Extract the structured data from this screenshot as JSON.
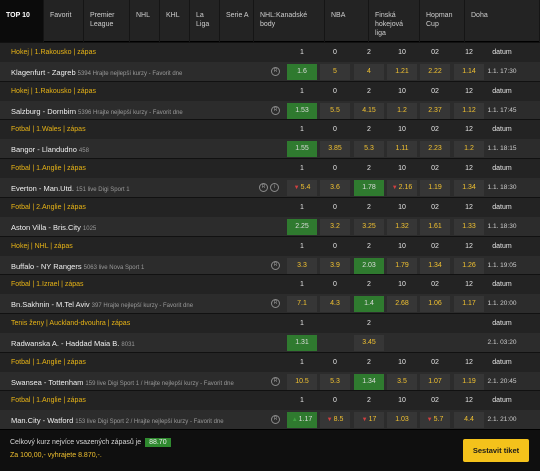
{
  "tabs": [
    "TOP 10",
    "Favorit",
    "Premier League",
    "NHL",
    "KHL",
    "La Liga",
    "Serie A",
    "NHL:Kanadské body",
    "NBA",
    "Finská hokejová liga",
    "Hopman Cup",
    "Doha"
  ],
  "col_headers": [
    "1",
    "0",
    "2",
    "10",
    "02",
    "12",
    "datum"
  ],
  "matches": [
    {
      "league": "Hokej | 1.Rakousko | zápas",
      "teams": "Klagenfurt - Zagreb",
      "info": "5394 Hrajte nejlepší kurzy - Favorit dne",
      "icons": [
        "R"
      ],
      "odds": [
        "1.6",
        "5",
        "4",
        "1.21",
        "2.22",
        "1.14"
      ],
      "selected": [
        0
      ],
      "arrows": [
        "",
        "",
        "",
        "",
        "",
        ""
      ],
      "date": "1.1. 17:30"
    },
    {
      "league": "Hokej | 1.Rakousko | zápas",
      "teams": "Salzburg - Dornbirn",
      "info": "5396 Hrajte nejlepší kurzy - Favorit dne",
      "icons": [
        "R"
      ],
      "odds": [
        "1.53",
        "5.5",
        "4.15",
        "1.2",
        "2.37",
        "1.12"
      ],
      "selected": [
        0
      ],
      "arrows": [
        "",
        "",
        "",
        "",
        "",
        ""
      ],
      "date": "1.1. 17:45"
    },
    {
      "league": "Fotbal | 1.Wales | zápas",
      "teams": "Bangor - Llandudno",
      "info": "458",
      "icons": [],
      "odds": [
        "1.55",
        "3.85",
        "5.3",
        "1.11",
        "2.23",
        "1.2"
      ],
      "selected": [
        0
      ],
      "arrows": [
        "",
        "",
        "",
        "",
        "",
        ""
      ],
      "date": "1.1. 18:15"
    },
    {
      "league": "Fotbal | 1.Anglie | zápas",
      "teams": "Everton - Man.Utd.",
      "info": "151 live Digi Sport 1",
      "icons": [
        "R",
        "i"
      ],
      "odds": [
        "5.4",
        "3.6",
        "1.78",
        "2.16",
        "1.19",
        "1.34"
      ],
      "selected": [
        2
      ],
      "arrows": [
        "down",
        "",
        "",
        "down",
        "",
        ""
      ],
      "date": "1.1. 18:30"
    },
    {
      "league": "Fotbal | 2.Anglie | zápas",
      "teams": "Aston Villa - Bris.City",
      "info": "1025",
      "icons": [],
      "odds": [
        "2.25",
        "3.2",
        "3.25",
        "1.32",
        "1.61",
        "1.33"
      ],
      "selected": [
        0
      ],
      "arrows": [
        "",
        "",
        "",
        "",
        "",
        ""
      ],
      "date": "1.1. 18:30"
    },
    {
      "league": "Hokej | NHL | zápas",
      "teams": "Buffalo - NY Rangers",
      "info": "5063 live Nova Sport 1",
      "icons": [
        "R"
      ],
      "odds": [
        "3.3",
        "3.9",
        "2.03",
        "1.79",
        "1.34",
        "1.26"
      ],
      "selected": [
        2
      ],
      "arrows": [
        "",
        "",
        "",
        "",
        "",
        ""
      ],
      "date": "1.1. 19:05"
    },
    {
      "league": "Fotbal | 1.Izrael | zápas",
      "teams": "Bn.Sakhnin - M.Tel Aviv",
      "info": "397 Hrajte nejlepší kurzy - Favorit dne",
      "icons": [
        "R"
      ],
      "odds": [
        "7.1",
        "4.3",
        "1.4",
        "2.68",
        "1.06",
        "1.17"
      ],
      "selected": [
        2
      ],
      "arrows": [
        "",
        "",
        "",
        "",
        "",
        ""
      ],
      "date": "1.1. 20:00"
    },
    {
      "league": "Tenis ženy | Auckland-dvouhra | zápas",
      "teams": "Radwanska A. - Haddad Maia B.",
      "info": "8031",
      "icons": [],
      "odds": [
        "1.31",
        "",
        "3.45",
        "",
        "",
        ""
      ],
      "selected": [
        0
      ],
      "arrows": [
        "",
        "",
        "",
        "",
        "",
        ""
      ],
      "date": "2.1. 03:20",
      "headers": [
        "1",
        "",
        "2",
        "",
        "",
        "",
        "datum"
      ]
    },
    {
      "league": "Fotbal | 1.Anglie | zápas",
      "teams": "Swansea - Tottenham",
      "info": "159 live Digi Sport 1 / Hrajte nejlepší kurzy - Favorit dne",
      "icons": [
        "R"
      ],
      "odds": [
        "10.5",
        "5.3",
        "1.34",
        "3.5",
        "1.07",
        "1.19"
      ],
      "selected": [
        2
      ],
      "arrows": [
        "",
        "",
        "",
        "",
        "",
        ""
      ],
      "date": "2.1. 20:45"
    },
    {
      "league": "Fotbal | 1.Anglie | zápas",
      "teams": "Man.City - Watford",
      "info": "153 live Digi Sport 2 / Hrajte nejlepší kurzy - Favorit dne",
      "icons": [
        "R"
      ],
      "odds": [
        "1.17",
        "8.5",
        "17",
        "1.03",
        "5.7",
        "4.4"
      ],
      "selected": [
        0
      ],
      "arrows": [
        "up",
        "down",
        "down",
        "",
        "down",
        ""
      ],
      "date": "2.1. 21:00"
    }
  ],
  "footer": {
    "total_label": "Celkový kurz nejvíce vsazených zápasů je",
    "total_value": "88.70",
    "bet_text": "Za 100,00,- vyhrajete 8.870,-.",
    "submit_label": "Sestavit tiket"
  },
  "colors": {
    "accent": "#f4c21b",
    "league": "#e8b416",
    "selected_odd": "#2f7a2f",
    "background": "#1a1a1a"
  }
}
